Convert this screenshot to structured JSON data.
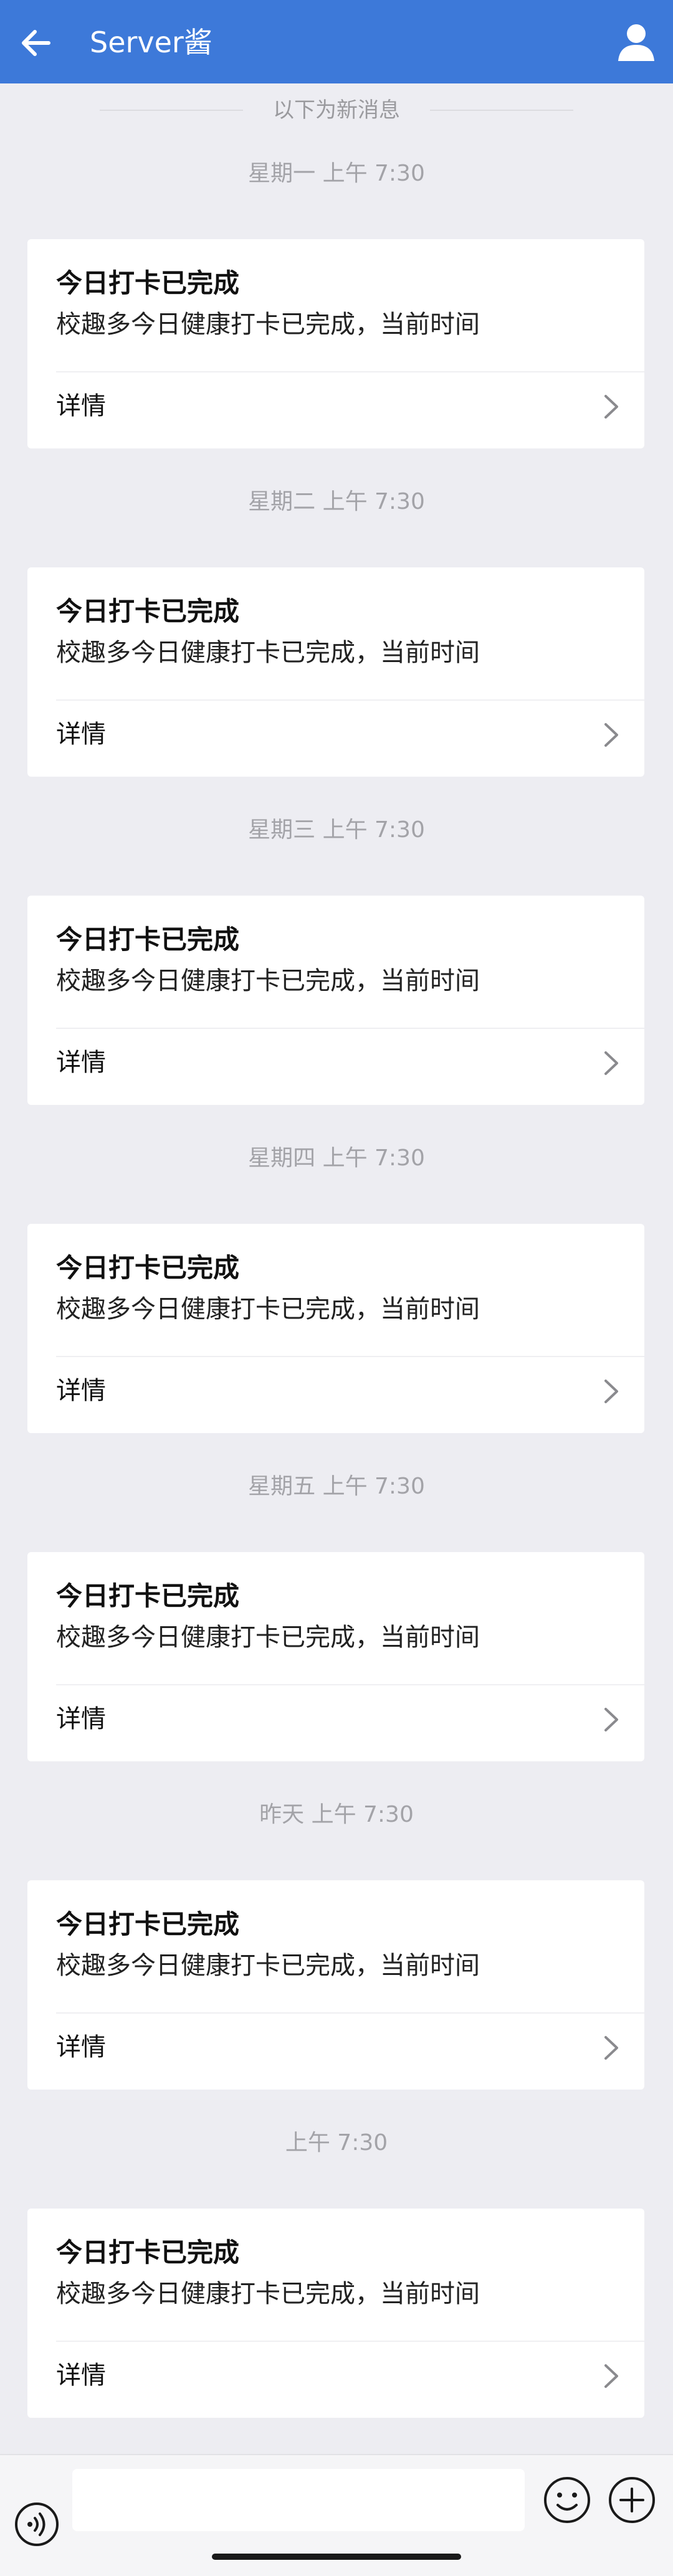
{
  "header": {
    "title": "Server酱",
    "color": "#3d79d9"
  },
  "divider": {
    "text": "以下为新消息"
  },
  "messages": [
    {
      "time": "星期一  上午 7:30",
      "title": "今日打卡已完成",
      "desc": "校趣多今日健康打卡已完成，当前时间",
      "detail": "详情"
    },
    {
      "time": "星期二  上午 7:30",
      "title": "今日打卡已完成",
      "desc": "校趣多今日健康打卡已完成，当前时间",
      "detail": "详情"
    },
    {
      "time": "星期三  上午 7:30",
      "title": "今日打卡已完成",
      "desc": "校趣多今日健康打卡已完成，当前时间",
      "detail": "详情"
    },
    {
      "time": "星期四  上午 7:30",
      "title": "今日打卡已完成",
      "desc": "校趣多今日健康打卡已完成，当前时间",
      "detail": "详情"
    },
    {
      "time": "星期五  上午 7:30",
      "title": "今日打卡已完成",
      "desc": "校趣多今日健康打卡已完成，当前时间",
      "detail": "详情"
    },
    {
      "time": "昨天  上午 7:30",
      "title": "今日打卡已完成",
      "desc": "校趣多今日健康打卡已完成，当前时间",
      "detail": "详情"
    },
    {
      "time": "上午 7:30",
      "title": "今日打卡已完成",
      "desc": "校趣多今日健康打卡已完成，当前时间",
      "detail": "详情"
    }
  ],
  "input": {
    "value": "",
    "placeholder": ""
  },
  "icons": {
    "back": "back-arrow-icon",
    "profile": "user-icon",
    "voice": "voice-icon",
    "emoji": "emoji-icon",
    "more": "plus-icon",
    "chevron": "chevron-right-icon"
  }
}
